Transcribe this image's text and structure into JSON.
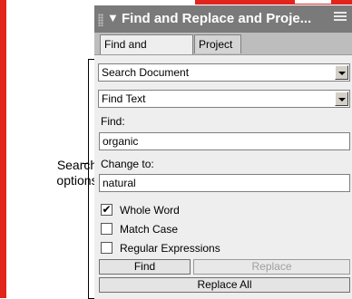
{
  "callout": {
    "label_line1": "Search",
    "label_line2": "options"
  },
  "panel": {
    "title": "Find and Replace and Proje...",
    "tabs": [
      {
        "label": "Find and Replace",
        "active": true
      },
      {
        "label": "Project",
        "active": false
      }
    ],
    "scope_select": {
      "value": "Search Document"
    },
    "mode_select": {
      "value": "Find Text"
    },
    "find": {
      "label": "Find:",
      "value": "organic"
    },
    "change": {
      "label": "Change to:",
      "value": "natural"
    },
    "options": [
      {
        "label": "Whole Word",
        "checked": true
      },
      {
        "label": "Match Case",
        "checked": false
      },
      {
        "label": "Regular Expressions",
        "checked": false
      }
    ],
    "buttons": {
      "find": "Find",
      "replace": "Replace",
      "replace_all": "Replace All"
    }
  },
  "colors": {
    "accent_red": "#e1241c",
    "titlebar": "#7a7a7a",
    "panel_bg": "#eeeeee"
  }
}
